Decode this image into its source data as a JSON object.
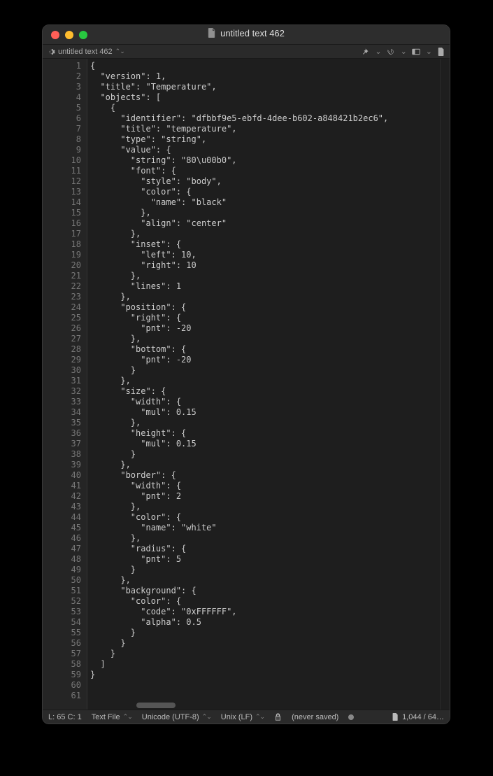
{
  "window": {
    "title": "untitled text 462"
  },
  "toolbar": {
    "doc_label": "untitled text 462"
  },
  "code_lines": [
    "{",
    "  \"version\": 1,",
    "  \"title\": \"Temperature\",",
    "  \"objects\": [",
    "    {",
    "      \"identifier\": \"dfbbf9e5-ebfd-4dee-b602-a848421b2ec6\",",
    "      \"title\": \"temperature\",",
    "      \"type\": \"string\",",
    "      \"value\": {",
    "        \"string\": \"80\\u00b0\",",
    "        \"font\": {",
    "          \"style\": \"body\",",
    "          \"color\": {",
    "            \"name\": \"black\"",
    "          },",
    "          \"align\": \"center\"",
    "        },",
    "        \"inset\": {",
    "          \"left\": 10,",
    "          \"right\": 10",
    "        },",
    "        \"lines\": 1",
    "      },",
    "      \"position\": {",
    "        \"right\": {",
    "          \"pnt\": -20",
    "        },",
    "        \"bottom\": {",
    "          \"pnt\": -20",
    "        }",
    "      },",
    "      \"size\": {",
    "        \"width\": {",
    "          \"mul\": 0.15",
    "        },",
    "        \"height\": {",
    "          \"mul\": 0.15",
    "        }",
    "      },",
    "      \"border\": {",
    "        \"width\": {",
    "          \"pnt\": 2",
    "        },",
    "        \"color\": {",
    "          \"name\": \"white\"",
    "        },",
    "        \"radius\": {",
    "          \"pnt\": 5",
    "        }",
    "      },",
    "      \"background\": {",
    "        \"color\": {",
    "          \"code\": \"0xFFFFFF\",",
    "          \"alpha\": 0.5",
    "        }",
    "      }",
    "    }",
    "  ]",
    "}",
    "",
    ""
  ],
  "status": {
    "position": "L: 65 C: 1",
    "file_type": "Text File",
    "encoding": "Unicode (UTF-8)",
    "line_endings": "Unix (LF)",
    "saved": "(never saved)",
    "size": "1,044 / 64…"
  }
}
